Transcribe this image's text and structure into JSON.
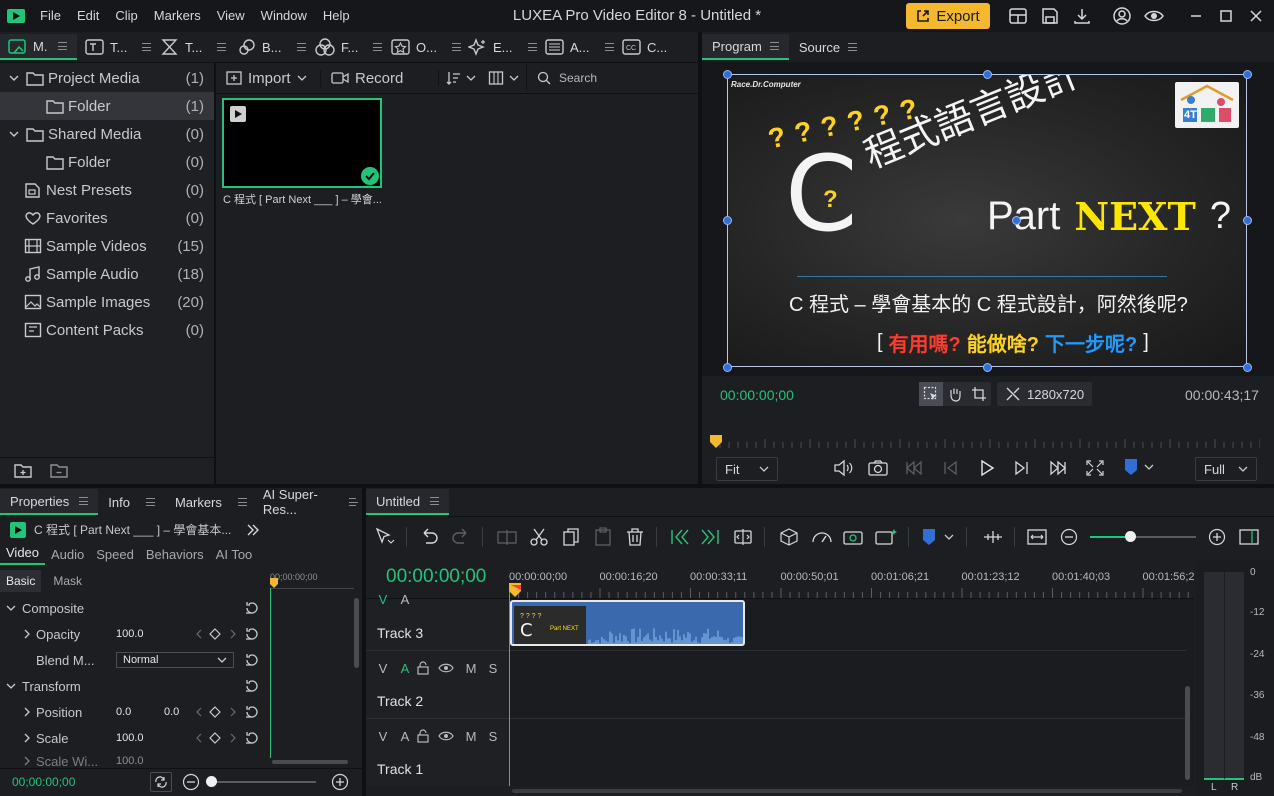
{
  "window": {
    "menu": [
      "File",
      "Edit",
      "Clip",
      "Markers",
      "View",
      "Window",
      "Help"
    ],
    "title": "LUXEA Pro Video Editor 8 - Untitled *",
    "export_label": "Export"
  },
  "media_tabs": [
    "M.",
    "T...",
    "T...",
    "B...",
    "F...",
    "O...",
    "E...",
    "A...",
    "C..."
  ],
  "tree": [
    {
      "label": "Project Media",
      "count": "(1)"
    },
    {
      "label": "Folder",
      "count": "(1)"
    },
    {
      "label": "Shared Media",
      "count": "(0)"
    },
    {
      "label": "Folder",
      "count": "(0)"
    },
    {
      "label": "Nest Presets",
      "count": "(0)"
    },
    {
      "label": "Favorites",
      "count": "(0)"
    },
    {
      "label": "Sample Videos",
      "count": "(15)"
    },
    {
      "label": "Sample Audio",
      "count": "(18)"
    },
    {
      "label": "Sample Images",
      "count": "(20)"
    },
    {
      "label": "Content Packs",
      "count": "(0)"
    }
  ],
  "media_toolbar": {
    "import": "Import",
    "record": "Record",
    "search_placeholder": "Search"
  },
  "clip_thumb": {
    "label": "C 程式 [ Part Next ___ ] – 學會..."
  },
  "preview": {
    "tabs": [
      "Program",
      "Source"
    ],
    "watermark": "Race.Dr.Computer",
    "qs": "? ? ? ? ? ?",
    "big_c": "C",
    "q_small": "?",
    "title": "程式語言設計",
    "part": "Part",
    "next": "NEXT",
    "qmark": "?",
    "subtitle": "C 程式 – 學會基本的 C 程式設計，阿然後呢?",
    "bracket_open": "[",
    "q1": "有用嗎?",
    "q2": "能做啥?",
    "q3": "下一步呢?",
    "bracket_close": "]",
    "logo_text": "4T",
    "time_current": "00:00:00;00",
    "resolution": "1280x720",
    "time_total": "00:00:43;17",
    "fit_select": "Fit",
    "quality_select": "Full"
  },
  "props": {
    "tabs": [
      "Properties",
      "Info",
      "Markers",
      "AI Super-Res..."
    ],
    "clip_name": "C 程式 [ Part Next ___ ] – 學會基本...",
    "subtabs": [
      "Video",
      "Audio",
      "Speed",
      "Behaviors",
      "AI Too"
    ],
    "subtabs2": [
      "Basic",
      "Mask"
    ],
    "mini_time": "00;00:00;00",
    "composite": "Composite",
    "opacity_label": "Opacity",
    "opacity_val": "100.0",
    "blend_label": "Blend M...",
    "blend_val": "Normal",
    "transform": "Transform",
    "position_label": "Position",
    "pos_x": "0.0",
    "pos_y": "0.0",
    "scale_label": "Scale",
    "scale_val": "100.0",
    "scalew_label": "Scale Wi...",
    "scalew_val": "100.0",
    "bottom_time": "00;00:00;00"
  },
  "timeline": {
    "tab": "Untitled",
    "current_time": "00:00:00;00",
    "ruler": [
      "00:00:00;00",
      "00:00:16;20",
      "00:00:33;11",
      "00:00:50;01",
      "00:01:06;21",
      "00:01:23;12",
      "00:01:40;03",
      "00:01:56;2"
    ],
    "tracks": [
      "Track 3",
      "Track 2",
      "Track 1"
    ],
    "track_ctrls": [
      "V",
      "A",
      "M",
      "S"
    ],
    "meter_ticks": [
      "0",
      "-12",
      "-24",
      "-36",
      "-48",
      "dB"
    ],
    "meter_lr": [
      "L",
      "R"
    ]
  },
  "colors": {
    "accent_green": "#23c37a",
    "export_yellow": "#f5b82e",
    "handle_blue": "#2f6fd6",
    "next_yellow": "#ffe600"
  }
}
